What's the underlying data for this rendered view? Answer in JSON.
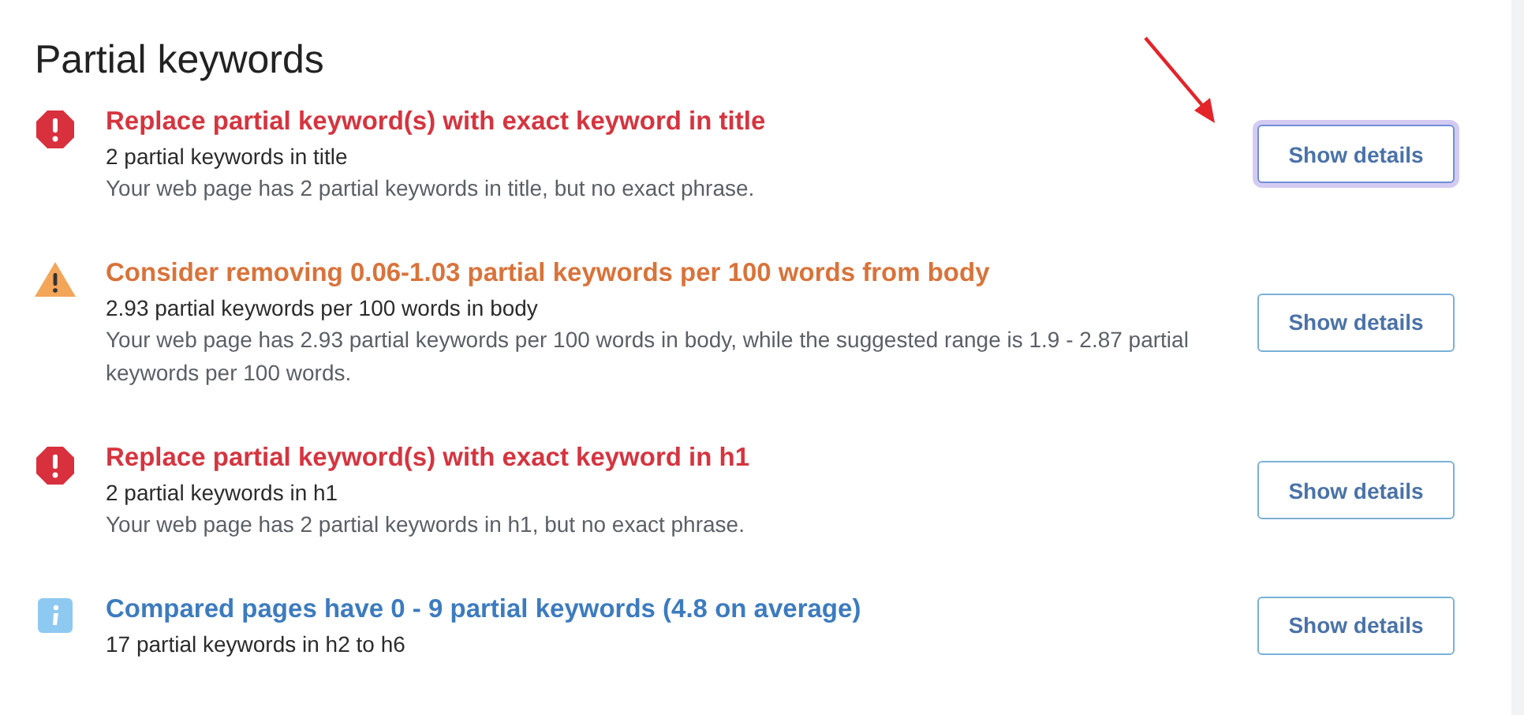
{
  "heading": "Partial keywords",
  "items": [
    {
      "kind": "error",
      "title": "Replace partial keyword(s) with exact keyword in title",
      "summary": "2 partial keywords in title",
      "detail": "Your web page has 2 partial keywords in title, but no exact phrase.",
      "button": {
        "label": "Show details",
        "focused": true
      }
    },
    {
      "kind": "warning",
      "title": "Consider removing 0.06-1.03 partial keywords per 100 words from body",
      "summary": "2.93 partial keywords per 100 words in body",
      "detail": "Your web page has 2.93 partial keywords per 100 words in body, while the suggested range is 1.9 - 2.87 partial keywords per 100 words.",
      "button": {
        "label": "Show details",
        "focused": false
      }
    },
    {
      "kind": "error",
      "title": "Replace partial keyword(s) with exact keyword in h1",
      "summary": "2 partial keywords in h1",
      "detail": "Your web page has 2 partial keywords in h1, but no exact phrase.",
      "button": {
        "label": "Show details",
        "focused": false
      }
    },
    {
      "kind": "info",
      "title": "Compared pages have 0 - 9 partial keywords (4.8 on average)",
      "summary": "17 partial keywords in h2 to h6",
      "button": {
        "label": "Show details",
        "focused": false
      }
    }
  ],
  "annotation": {
    "kind": "arrow"
  }
}
